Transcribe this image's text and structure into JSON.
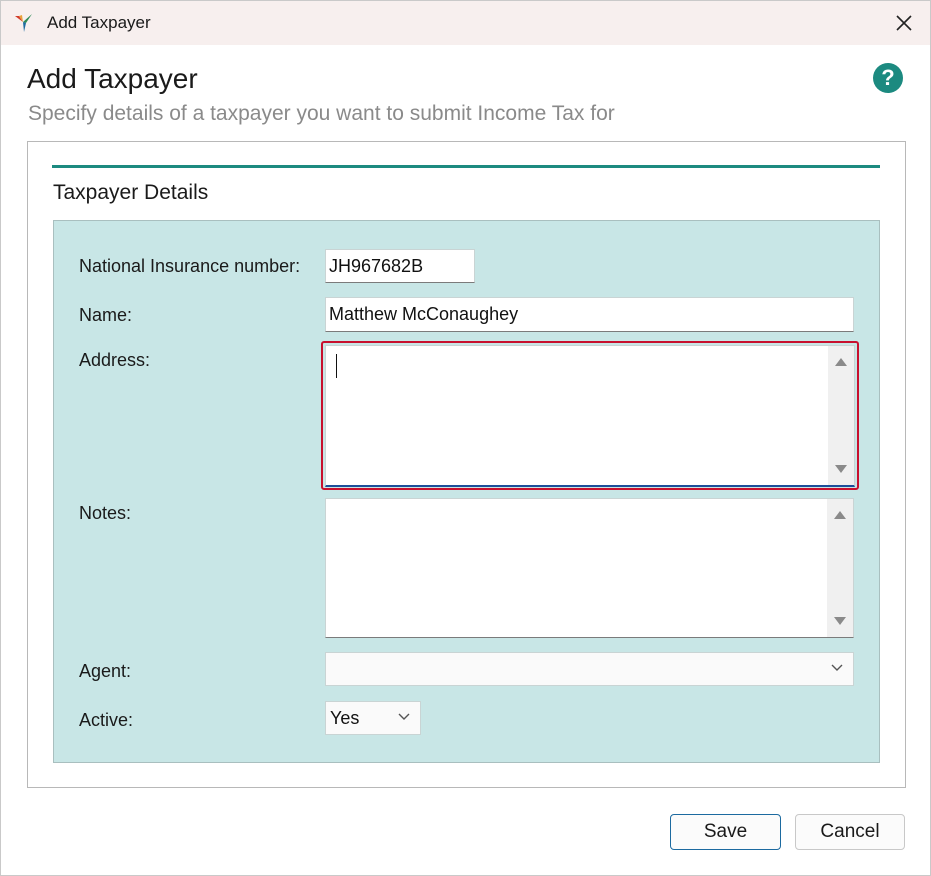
{
  "window": {
    "title": "Add Taxpayer"
  },
  "header": {
    "title": "Add Taxpayer",
    "subtitle": "Specify details of a taxpayer you want to submit Income Tax for",
    "help_label": "?"
  },
  "section": {
    "title": "Taxpayer Details"
  },
  "form": {
    "ni_label": "National Insurance number:",
    "ni_value": "JH967682B",
    "name_label": "Name:",
    "name_value": "Matthew McConaughey",
    "address_label": "Address:",
    "address_value": "",
    "notes_label": "Notes:",
    "notes_value": "",
    "agent_label": "Agent:",
    "agent_value": "",
    "active_label": "Active:",
    "active_value": "Yes"
  },
  "buttons": {
    "save": "Save",
    "cancel": "Cancel"
  },
  "colors": {
    "accent": "#1c8a80",
    "panel": "#c8e6e6",
    "focus": "#c8102e",
    "titlebar": "#f7efee"
  }
}
